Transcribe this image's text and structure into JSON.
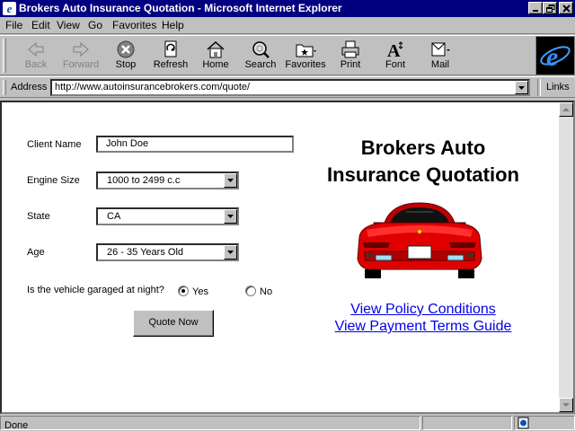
{
  "window": {
    "title": "Brokers Auto Insurance Quotation - Microsoft Internet Explorer"
  },
  "menu": [
    "File",
    "Edit",
    "View",
    "Go",
    "Favorites",
    "Help"
  ],
  "toolbar": [
    {
      "label": "Back",
      "icon": "back-arrow-icon",
      "enabled": false
    },
    {
      "label": "Forward",
      "icon": "forward-arrow-icon",
      "enabled": false
    },
    {
      "label": "Stop",
      "icon": "stop-icon",
      "enabled": true
    },
    {
      "label": "Refresh",
      "icon": "refresh-icon",
      "enabled": true
    },
    {
      "label": "Home",
      "icon": "home-icon",
      "enabled": true
    },
    {
      "label": "Search",
      "icon": "search-icon",
      "enabled": true
    },
    {
      "label": "Favorites",
      "icon": "favorites-icon",
      "enabled": true
    },
    {
      "label": "Print",
      "icon": "print-icon",
      "enabled": true
    },
    {
      "label": "Font",
      "icon": "font-icon",
      "enabled": true
    },
    {
      "label": "Mail",
      "icon": "mail-icon",
      "enabled": true
    }
  ],
  "address": {
    "label": "Address",
    "url": "http://www.autoinsurancebrokers.com/quote/",
    "links_label": "Links"
  },
  "form": {
    "client_name_label": "Client Name",
    "client_name_value": "John Doe",
    "engine_size_label": "Engine Size",
    "engine_size_value": "1000 to 2499 c.c",
    "state_label": "State",
    "state_value": "CA",
    "age_label": "Age",
    "age_value": "26 - 35 Years Old",
    "garaged_question": "Is the vehicle garaged at night?",
    "garaged_yes": "Yes",
    "garaged_no": "No",
    "garaged_selected": "Yes",
    "submit_label": "Quote Now"
  },
  "heading": {
    "line1": "Brokers Auto",
    "line2": "Insurance Quotation"
  },
  "links": {
    "policy": "View Policy Conditions",
    "payment": "View Payment Terms Guide"
  },
  "status": {
    "text": "Done"
  },
  "colors": {
    "title_bar": "#000080",
    "car_body": "#e00000",
    "link": "#0000ee"
  }
}
